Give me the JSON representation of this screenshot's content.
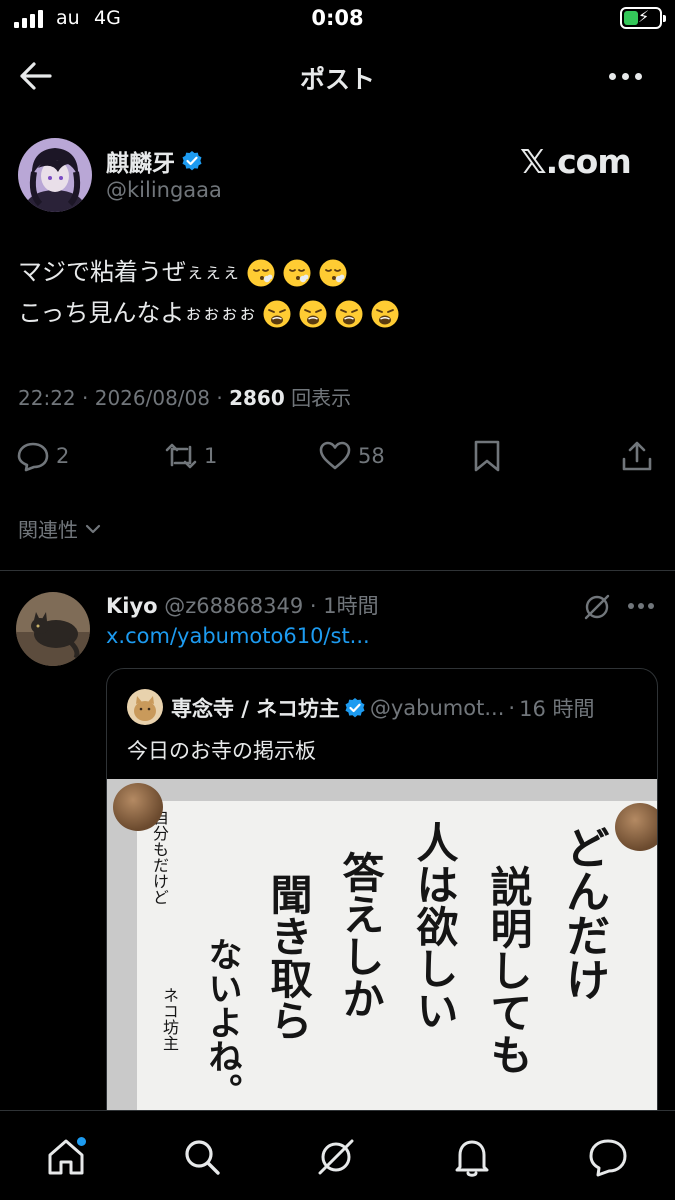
{
  "status_bar": {
    "carrier": "au",
    "network": "4G",
    "time": "0:08"
  },
  "header": {
    "title": "ポスト"
  },
  "post": {
    "author_name": "麒麟牙",
    "author_handle": "@kilingaaa",
    "brand_watermark": "𝕏.com",
    "line1_main": "マジで粘着うぜ",
    "line1_small": "ぇぇぇ",
    "line2_main": "こっち見んなよ",
    "line2_small": "ぉぉぉぉ",
    "line1_emoji": [
      "face-exhaling-emoji",
      "face-exhaling-emoji",
      "face-exhaling-emoji"
    ],
    "line2_emoji": [
      "weary-face-emoji",
      "weary-face-emoji",
      "weary-face-emoji",
      "weary-face-emoji"
    ],
    "time": "22:22",
    "date": "2026/08/08",
    "view_count": "2860",
    "view_label": "回表示",
    "separator": "·"
  },
  "actions": {
    "replies": "2",
    "reposts": "1",
    "likes": "58"
  },
  "relevance_label": "関連性",
  "reply": {
    "name": "Kiyo",
    "handle": "@z68868349",
    "time": "1時間",
    "link": "x.com/yabumoto610/st..."
  },
  "quote": {
    "name": "専念寺 / ネコ坊主",
    "handle": "@yabumot...",
    "time": "16 時間",
    "text": "今日のお寺の掲示板",
    "board_col1": "どんだけ",
    "board_col2": "説明しても",
    "board_col3": "人は欲しい",
    "board_col4": "答えしか",
    "board_col5": "聞き取ら",
    "board_col6": "ないよね。",
    "board_side": "自分もだけど",
    "board_sign": "ネコ坊主"
  },
  "colors": {
    "background": "#000000",
    "text": "#e7e9ea",
    "muted": "#71767b",
    "accent": "#1d9bf0",
    "border": "#2f3336"
  }
}
